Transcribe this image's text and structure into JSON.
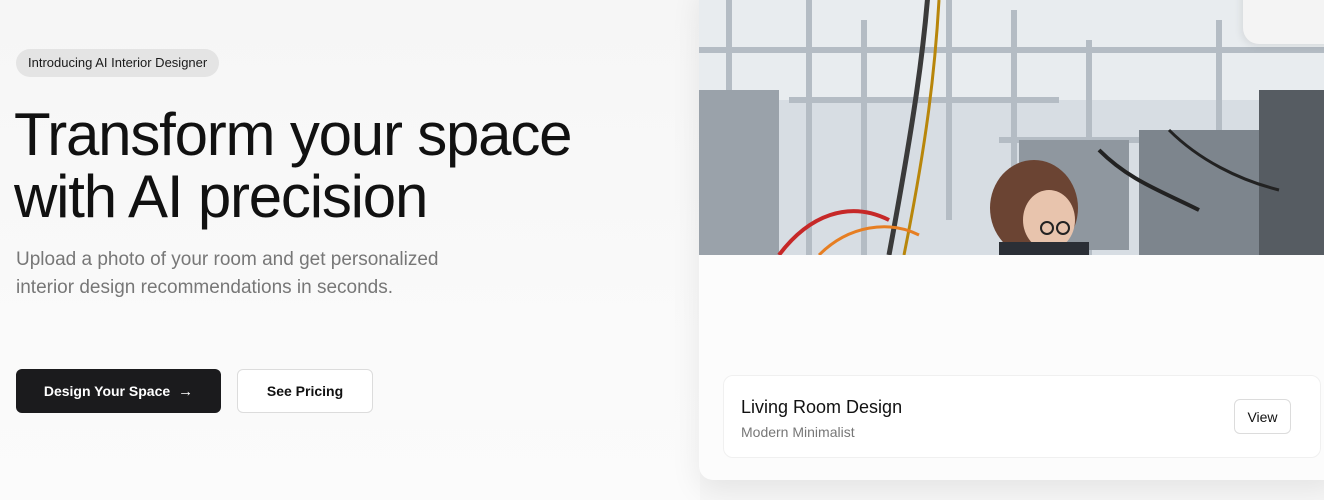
{
  "hero": {
    "badge": "Introducing AI Interior Designer",
    "headline_line1": "Transform your space",
    "headline_line2": "with AI precision",
    "subtext": "Upload a photo of your room and get personalized interior design recommendations in seconds.",
    "primary_button": "Design Your Space",
    "primary_button_icon": "arrow-right-icon",
    "secondary_button": "See Pricing"
  },
  "preview_card": {
    "image_subject": "lab-workbench-photo",
    "title": "Living Room Design",
    "subtitle": "Modern Minimalist",
    "view_button": "View"
  },
  "colors": {
    "primary_button_bg": "#1b1b1d",
    "badge_bg": "#e4e4e4",
    "muted_text": "#777777"
  }
}
